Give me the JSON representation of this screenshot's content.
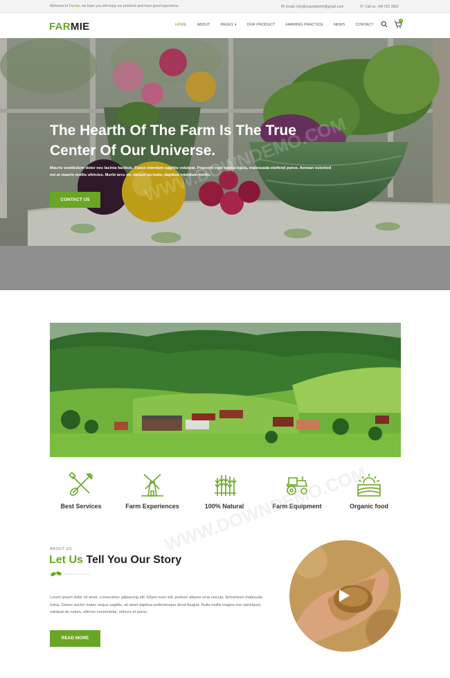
{
  "topbar": {
    "welcome_prefix": "Welcome to ",
    "welcome_brand": "Farmie",
    "welcome_suffix": ", we hope you will enjoy our products and have good experience",
    "email": "Email: info@exampleinfo@gmail.com",
    "phone": "Call us: +84 022 3902"
  },
  "header": {
    "logo_first": "FAR",
    "logo_second": "MIE",
    "nav": [
      "HOME",
      "ABOUT",
      "PAGES",
      "OUR PRODUCT",
      "FARMING PRACTICE",
      "NEWS",
      "CONTACT"
    ],
    "cart_count": "0"
  },
  "hero": {
    "title": "The Hearth Of The Farm Is The True Center Of Our Universe.",
    "text": "Mauris vestibulum dolor nec lacinia facilisis. Fusce interdum sagittis volutpat. Praesent eget varius ligula, malesuada eleifend purus. Aenean euismod est at mauris mollis ultricies. Morbi arcu mi, dictum eu iusto, dapibus interdum mollis.",
    "button": "CONTACT US"
  },
  "features": [
    {
      "label": "Best Services",
      "icon": "shovel-fork-icon"
    },
    {
      "label": "Farm Experiences",
      "icon": "windmill-icon"
    },
    {
      "label": "100% Natural",
      "icon": "wheat-icon"
    },
    {
      "label": "Farm Equipment",
      "icon": "tractor-icon"
    },
    {
      "label": "Organic food",
      "icon": "sun-field-icon"
    }
  ],
  "about": {
    "kicker": "ABOUT US",
    "title_green": "Let Us",
    "title_rest": " Tell You Our Story",
    "text": "Lorem ipsum dolor sit amet, consectetur adipiscing elit. Etiam nunc elit, pretium atlanta urna veicula, fermentum malesuda nvlna. Donec auctor malec neque sagittis, sit amet dapibus pellentesque dond feugiat. Nulla mollis magna non sanetquet, volutpat de cutum, ultrices consectetur, ultrices et purus.",
    "button": "READ MORE"
  },
  "colors": {
    "accent": "#6aa625",
    "topbar": "#f3f3f3",
    "band": "#8f8f8f"
  }
}
